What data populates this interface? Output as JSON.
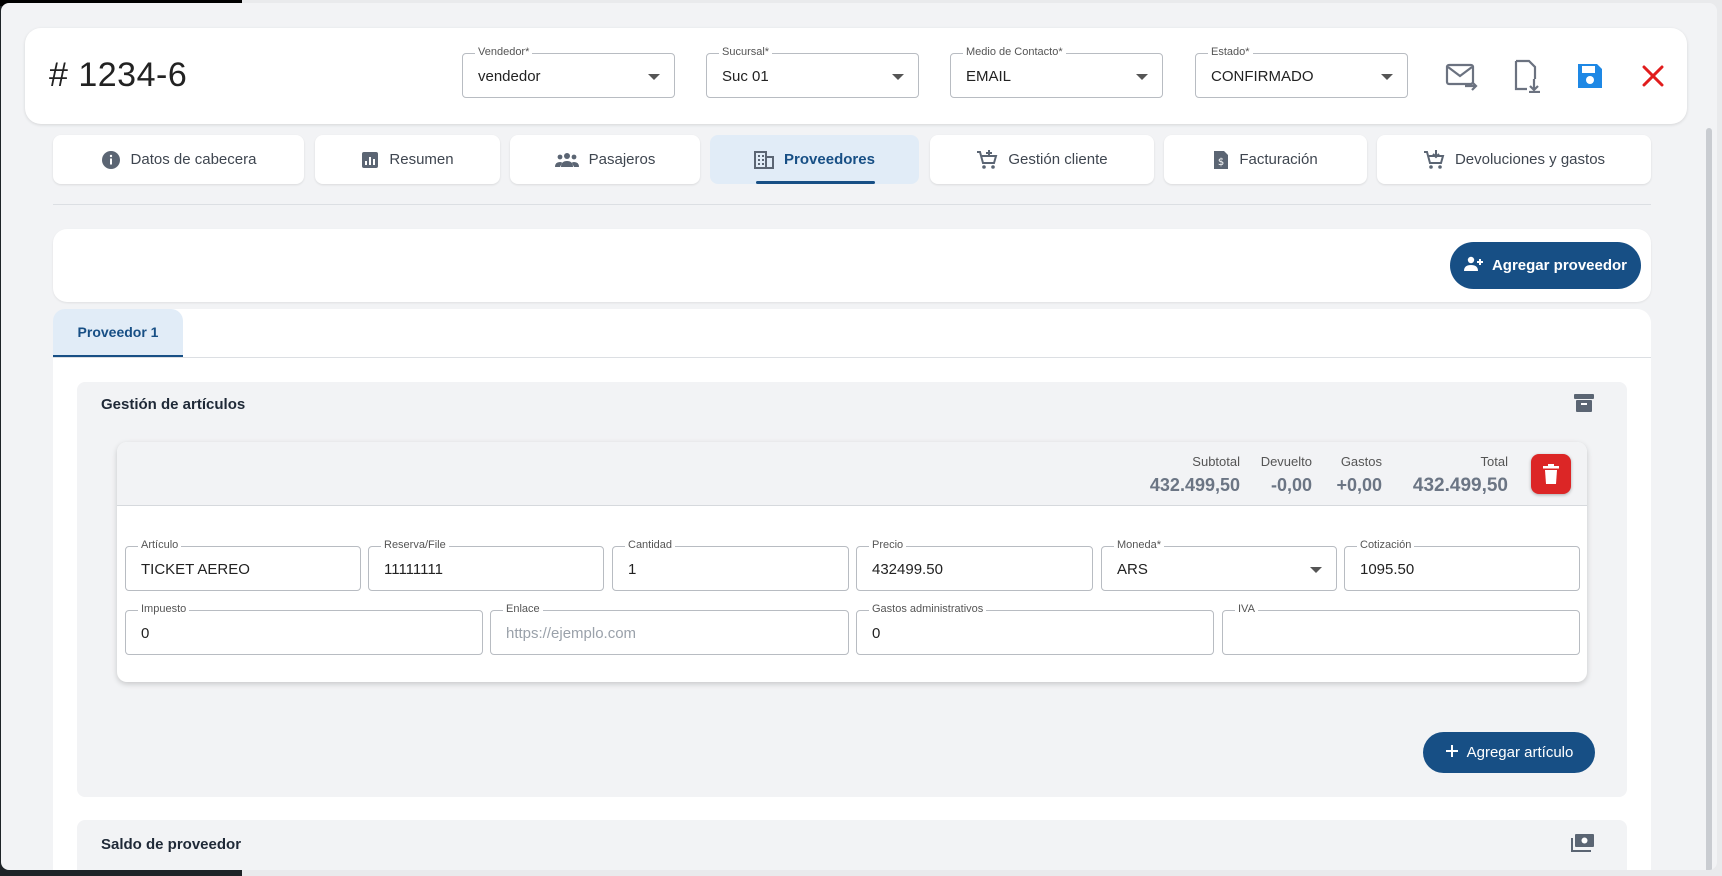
{
  "header": {
    "order_number": "# 1234-6",
    "selects": [
      {
        "label": "Vendedor*",
        "value": "vendedor"
      },
      {
        "label": "Sucursal*",
        "value": "Suc 01"
      },
      {
        "label": "Medio de Contacto*",
        "value": "EMAIL"
      },
      {
        "label": "Estado*",
        "value": "CONFIRMADO"
      }
    ],
    "icons": [
      "send-email-icon",
      "download-file-icon",
      "save-icon",
      "close-icon"
    ]
  },
  "tabs": [
    {
      "label": "Datos de cabecera",
      "icon": "info-icon"
    },
    {
      "label": "Resumen",
      "icon": "chart-icon"
    },
    {
      "label": "Pasajeros",
      "icon": "group-icon"
    },
    {
      "label": "Proveedores",
      "icon": "building-icon",
      "active": true
    },
    {
      "label": "Gestión cliente",
      "icon": "cart-add-icon"
    },
    {
      "label": "Facturación",
      "icon": "invoice-icon"
    },
    {
      "label": "Devoluciones y gastos",
      "icon": "cart-return-icon"
    }
  ],
  "add_provider_label": "Agregar proveedor",
  "provider_tab": "Proveedor 1",
  "articles_section": {
    "title": "Gestión de artículos",
    "totals": [
      {
        "label": "Subtotal",
        "value": "432.499,50"
      },
      {
        "label": "Devuelto",
        "value": "-0,00"
      },
      {
        "label": "Gastos",
        "value": "+0,00"
      },
      {
        "label": "Total",
        "value": "432.499,50"
      }
    ],
    "row1": [
      {
        "label": "Artículo",
        "value": "TICKET AEREO"
      },
      {
        "label": "Reserva/File",
        "value": "11111111"
      },
      {
        "label": "Cantidad",
        "value": "1"
      },
      {
        "label": "Precio",
        "value": "432499.50"
      },
      {
        "label": "Moneda*",
        "value": "ARS"
      },
      {
        "label": "Cotización",
        "value": "1095.50"
      }
    ],
    "row2": [
      {
        "label": "Impuesto",
        "value": "0"
      },
      {
        "label": "Enlace",
        "placeholder": "https://ejemplo.com"
      },
      {
        "label": "Gastos administrativos",
        "value": "0"
      },
      {
        "label": "IVA",
        "value": ""
      }
    ],
    "add_article_label": "Agregar artículo"
  },
  "balance_section": {
    "title": "Saldo de proveedor"
  },
  "colors": {
    "primary": "#174f85",
    "danger": "#dc2626",
    "save_icon": "#1e88e5",
    "close_icon": "#e11d1d"
  }
}
